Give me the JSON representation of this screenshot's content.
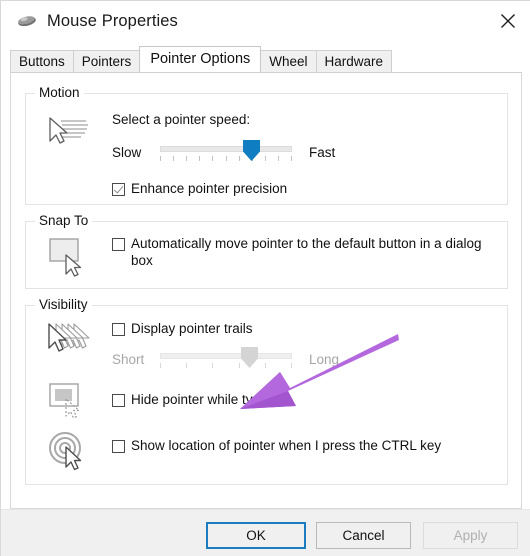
{
  "window": {
    "title": "Mouse Properties",
    "icon": "mouse-icon",
    "close_label": "Close"
  },
  "tabs": [
    {
      "label": "Buttons",
      "active": false
    },
    {
      "label": "Pointers",
      "active": false
    },
    {
      "label": "Pointer Options",
      "active": true
    },
    {
      "label": "Wheel",
      "active": false
    },
    {
      "label": "Hardware",
      "active": false
    }
  ],
  "groups": {
    "motion": {
      "title": "Motion",
      "icon": "pointer-speed-icon",
      "speed_label": "Select a pointer speed:",
      "slider": {
        "min_label": "Slow",
        "max_label": "Fast",
        "value_percent": 72,
        "ticks": 11,
        "enabled": true
      },
      "enhance_precision": {
        "label": "Enhance pointer precision",
        "checked": true
      }
    },
    "snap_to": {
      "title": "Snap To",
      "icon": "snap-to-default-button-icon",
      "auto_move": {
        "label": "Automatically move pointer to the default button in a dialog box",
        "checked": false
      }
    },
    "visibility": {
      "title": "Visibility",
      "trails_icon": "pointer-trails-icon",
      "hide_icon": "hide-pointer-while-typing-icon",
      "locate_icon": "show-pointer-location-icon",
      "display_trails": {
        "label": "Display pointer trails",
        "checked": false
      },
      "trails_slider": {
        "min_label": "Short",
        "max_label": "Long",
        "value_percent": 70,
        "ticks": 6,
        "enabled": false
      },
      "hide_while_typing": {
        "label": "Hide pointer while typing",
        "checked": false
      },
      "show_location": {
        "label": "Show location of pointer when I press the CTRL key",
        "checked": false
      }
    }
  },
  "footer": {
    "ok": "OK",
    "cancel": "Cancel",
    "apply": "Apply",
    "apply_disabled": true
  },
  "annotation": {
    "type": "arrow",
    "points_to": "Hide pointer while typing",
    "color": "#b368dd"
  },
  "colors": {
    "accent": "#0f7dc2",
    "focus_border": "#1c7cc0",
    "annotation": "#b368dd",
    "panel": "#ffffff",
    "footer": "#f0f0f0"
  }
}
